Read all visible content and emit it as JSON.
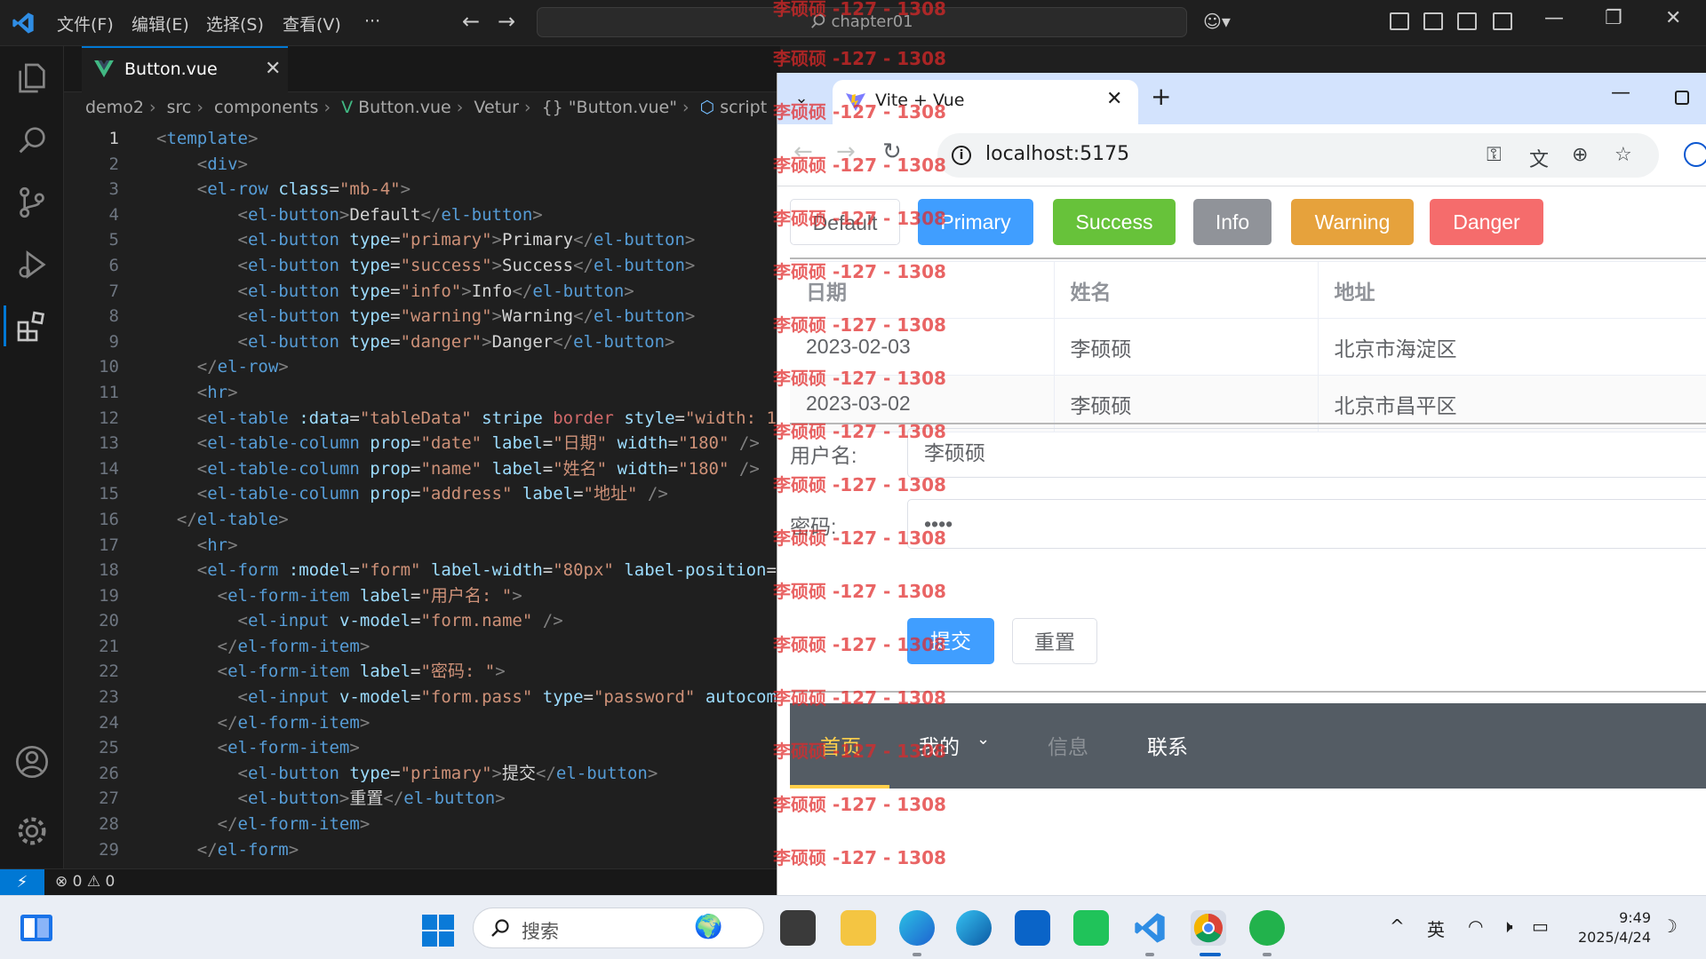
{
  "titlebar": {
    "menus": [
      "文件(F)",
      "编辑(E)",
      "选择(S)",
      "查看(V)",
      "···"
    ],
    "command_center": "chapter01"
  },
  "editor": {
    "tab": {
      "filename": "Button.vue"
    },
    "breadcrumb": [
      "demo2",
      "src",
      "components",
      "Button.vue",
      "Vetur",
      "{} \"Button.vue\"",
      "script"
    ],
    "active_line": 1,
    "lines": [
      "1",
      "2",
      "3",
      "4",
      "5",
      "6",
      "7",
      "8",
      "9",
      "10",
      "11",
      "12",
      "13",
      "14",
      "15",
      "16",
      "17",
      "18",
      "19",
      "20",
      "21",
      "22",
      "23",
      "24",
      "25",
      "26",
      "27",
      "28",
      "29"
    ]
  },
  "statusbar": {
    "errors": "0",
    "warnings": "0"
  },
  "browser": {
    "tab_title": "Vite + Vue",
    "url": "localhost:5175",
    "buttons": [
      {
        "label": "Default",
        "color": "#ffffff"
      },
      {
        "label": "Primary",
        "color": "#409eff"
      },
      {
        "label": "Success",
        "color": "#67c23a"
      },
      {
        "label": "Info",
        "color": "#909399"
      },
      {
        "label": "Warning",
        "color": "#e6a23c"
      },
      {
        "label": "Danger",
        "color": "#f56c6c"
      }
    ],
    "table": {
      "headers": [
        "日期",
        "姓名",
        "地址"
      ],
      "rows": [
        [
          "2023-02-03",
          "李硕硕",
          "北京市海淀区"
        ],
        [
          "2023-03-02",
          "李硕硕",
          "北京市昌平区"
        ]
      ]
    },
    "form": {
      "username_label": "用户名:",
      "username_value": "李硕硕",
      "password_label": "密码:",
      "password_value": "••••",
      "submit_label": "提交",
      "reset_label": "重置"
    },
    "menu": {
      "items": [
        "首页",
        "我的",
        "信息",
        "联系"
      ],
      "active_color": "#ffd04b",
      "background": "#545c64"
    }
  },
  "watermark": "李硕硕 -127 - 1308",
  "taskbar": {
    "search_placeholder": "搜索",
    "ime": "英",
    "time": "9:49",
    "date": "2025/4/24"
  }
}
